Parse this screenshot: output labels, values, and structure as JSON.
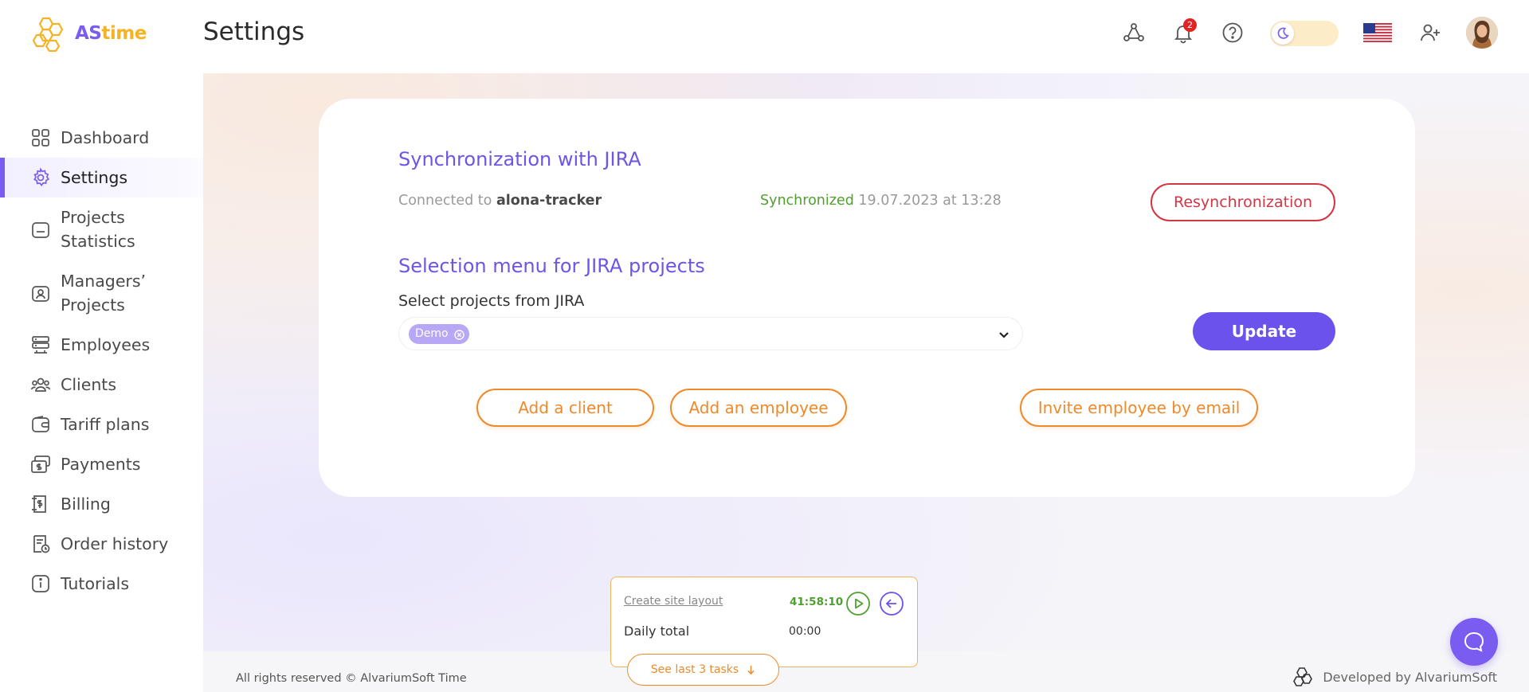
{
  "app": {
    "brand_as": "AS",
    "brand_time": "time",
    "page_title": "Settings"
  },
  "header": {
    "icons": [
      "network-icon",
      "bell-icon",
      "help-icon",
      "moon-icon",
      "us-flag-icon",
      "add-user-icon"
    ],
    "notifications_count": "2",
    "theme": "light"
  },
  "sidebar": {
    "items": [
      {
        "label": "Dashboard",
        "icon": "dashboard-icon",
        "active": false
      },
      {
        "label": "Settings",
        "icon": "gear-icon",
        "active": true
      },
      {
        "label": "Projects Statistics",
        "icon": "folder-icon",
        "active": false
      },
      {
        "label": "Managers’ Projects",
        "icon": "manager-icon",
        "active": false
      },
      {
        "label": "Employees",
        "icon": "employees-icon",
        "active": false
      },
      {
        "label": "Clients",
        "icon": "clients-icon",
        "active": false
      },
      {
        "label": "Tariff plans",
        "icon": "wallet-icon",
        "active": false
      },
      {
        "label": "Payments",
        "icon": "payments-icon",
        "active": false
      },
      {
        "label": "Billing",
        "icon": "billing-icon",
        "active": false
      },
      {
        "label": "Order history",
        "icon": "order-history-icon",
        "active": false
      },
      {
        "label": "Tutorials",
        "icon": "info-icon",
        "active": false
      }
    ]
  },
  "sync": {
    "title": "Synchronization with JIRA",
    "connected_prefix": "Connected to",
    "connected_account": "alona-tracker",
    "status_label": "Synchronized",
    "status_time": "19.07.2023 at 13:28",
    "resync_button": "Resynchronization"
  },
  "selection": {
    "title": "Selection menu for JIRA projects",
    "select_label": "Select projects from JIRA",
    "selected_tags": [
      "Demo"
    ],
    "update_button": "Update"
  },
  "actions": {
    "add_client": "Add a client",
    "add_employee": "Add an employee",
    "invite_employee": "Invite employee by email"
  },
  "timer": {
    "task_name": "Create site layout",
    "elapsed": "41:58:10",
    "daily_total_label": "Daily total",
    "daily_total_value": "00:00",
    "see_last_button": "See last 3 tasks"
  },
  "footer": {
    "copyright": "All rights reserved © AlvariumSoft Time",
    "developer": "Developed by AlvariumSoft"
  },
  "colors": {
    "accent": "#6c52ec",
    "orange": "#ee8a2a",
    "danger": "#d43545",
    "success": "#4fa030"
  }
}
